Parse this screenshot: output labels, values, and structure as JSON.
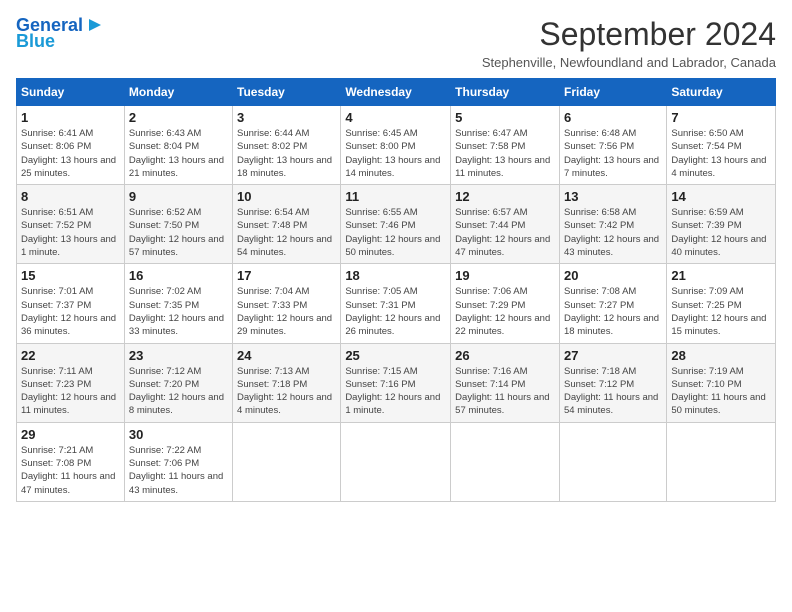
{
  "logo": {
    "line1": "General",
    "line2": "Blue"
  },
  "header": {
    "title": "September 2024",
    "subtitle": "Stephenville, Newfoundland and Labrador, Canada"
  },
  "weekdays": [
    "Sunday",
    "Monday",
    "Tuesday",
    "Wednesday",
    "Thursday",
    "Friday",
    "Saturday"
  ],
  "weeks": [
    [
      {
        "day": "1",
        "sunrise": "6:41 AM",
        "sunset": "8:06 PM",
        "daylight": "13 hours and 25 minutes."
      },
      {
        "day": "2",
        "sunrise": "6:43 AM",
        "sunset": "8:04 PM",
        "daylight": "13 hours and 21 minutes."
      },
      {
        "day": "3",
        "sunrise": "6:44 AM",
        "sunset": "8:02 PM",
        "daylight": "13 hours and 18 minutes."
      },
      {
        "day": "4",
        "sunrise": "6:45 AM",
        "sunset": "8:00 PM",
        "daylight": "13 hours and 14 minutes."
      },
      {
        "day": "5",
        "sunrise": "6:47 AM",
        "sunset": "7:58 PM",
        "daylight": "13 hours and 11 minutes."
      },
      {
        "day": "6",
        "sunrise": "6:48 AM",
        "sunset": "7:56 PM",
        "daylight": "13 hours and 7 minutes."
      },
      {
        "day": "7",
        "sunrise": "6:50 AM",
        "sunset": "7:54 PM",
        "daylight": "13 hours and 4 minutes."
      }
    ],
    [
      {
        "day": "8",
        "sunrise": "6:51 AM",
        "sunset": "7:52 PM",
        "daylight": "13 hours and 1 minute."
      },
      {
        "day": "9",
        "sunrise": "6:52 AM",
        "sunset": "7:50 PM",
        "daylight": "12 hours and 57 minutes."
      },
      {
        "day": "10",
        "sunrise": "6:54 AM",
        "sunset": "7:48 PM",
        "daylight": "12 hours and 54 minutes."
      },
      {
        "day": "11",
        "sunrise": "6:55 AM",
        "sunset": "7:46 PM",
        "daylight": "12 hours and 50 minutes."
      },
      {
        "day": "12",
        "sunrise": "6:57 AM",
        "sunset": "7:44 PM",
        "daylight": "12 hours and 47 minutes."
      },
      {
        "day": "13",
        "sunrise": "6:58 AM",
        "sunset": "7:42 PM",
        "daylight": "12 hours and 43 minutes."
      },
      {
        "day": "14",
        "sunrise": "6:59 AM",
        "sunset": "7:39 PM",
        "daylight": "12 hours and 40 minutes."
      }
    ],
    [
      {
        "day": "15",
        "sunrise": "7:01 AM",
        "sunset": "7:37 PM",
        "daylight": "12 hours and 36 minutes."
      },
      {
        "day": "16",
        "sunrise": "7:02 AM",
        "sunset": "7:35 PM",
        "daylight": "12 hours and 33 minutes."
      },
      {
        "day": "17",
        "sunrise": "7:04 AM",
        "sunset": "7:33 PM",
        "daylight": "12 hours and 29 minutes."
      },
      {
        "day": "18",
        "sunrise": "7:05 AM",
        "sunset": "7:31 PM",
        "daylight": "12 hours and 26 minutes."
      },
      {
        "day": "19",
        "sunrise": "7:06 AM",
        "sunset": "7:29 PM",
        "daylight": "12 hours and 22 minutes."
      },
      {
        "day": "20",
        "sunrise": "7:08 AM",
        "sunset": "7:27 PM",
        "daylight": "12 hours and 18 minutes."
      },
      {
        "day": "21",
        "sunrise": "7:09 AM",
        "sunset": "7:25 PM",
        "daylight": "12 hours and 15 minutes."
      }
    ],
    [
      {
        "day": "22",
        "sunrise": "7:11 AM",
        "sunset": "7:23 PM",
        "daylight": "12 hours and 11 minutes."
      },
      {
        "day": "23",
        "sunrise": "7:12 AM",
        "sunset": "7:20 PM",
        "daylight": "12 hours and 8 minutes."
      },
      {
        "day": "24",
        "sunrise": "7:13 AM",
        "sunset": "7:18 PM",
        "daylight": "12 hours and 4 minutes."
      },
      {
        "day": "25",
        "sunrise": "7:15 AM",
        "sunset": "7:16 PM",
        "daylight": "12 hours and 1 minute."
      },
      {
        "day": "26",
        "sunrise": "7:16 AM",
        "sunset": "7:14 PM",
        "daylight": "11 hours and 57 minutes."
      },
      {
        "day": "27",
        "sunrise": "7:18 AM",
        "sunset": "7:12 PM",
        "daylight": "11 hours and 54 minutes."
      },
      {
        "day": "28",
        "sunrise": "7:19 AM",
        "sunset": "7:10 PM",
        "daylight": "11 hours and 50 minutes."
      }
    ],
    [
      {
        "day": "29",
        "sunrise": "7:21 AM",
        "sunset": "7:08 PM",
        "daylight": "11 hours and 47 minutes."
      },
      {
        "day": "30",
        "sunrise": "7:22 AM",
        "sunset": "7:06 PM",
        "daylight": "11 hours and 43 minutes."
      },
      null,
      null,
      null,
      null,
      null
    ]
  ]
}
